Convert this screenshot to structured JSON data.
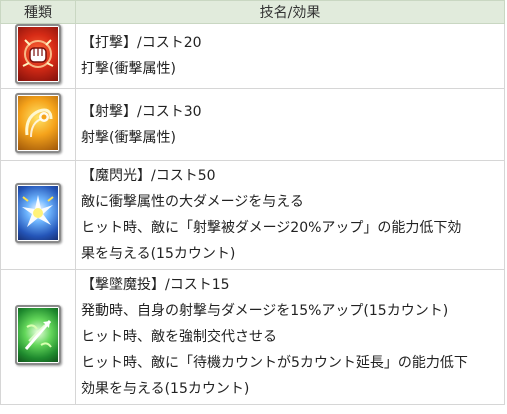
{
  "header": {
    "col_type": "種類",
    "col_effect": "技名/効果"
  },
  "rows": [
    {
      "icon": "fist-strike-icon",
      "color": "#d62b16",
      "lines": [
        "【打撃】/コスト20",
        "打撃(衝撃属性)"
      ]
    },
    {
      "icon": "shot-swirl-icon",
      "color": "#f5a31b",
      "lines": [
        "【射撃】/コスト30",
        "射撃(衝撃属性)"
      ]
    },
    {
      "icon": "magic-flash-icon",
      "color": "#2455b8",
      "lines": [
        "【魔閃光】/コスト50",
        "敵に衝撃属性の大ダメージを与える",
        "ヒット時、敵に「射撃被ダメージ20%アップ」の能力低下効",
        "果を与える(15カウント)"
      ]
    },
    {
      "icon": "crash-magic-throw-icon",
      "color": "#1f8a2e",
      "lines": [
        "【撃墜魔投】/コスト15",
        "発動時、自身の射撃与ダメージを15%アップ(15カウント)",
        "ヒット時、敵を強制交代させる",
        "ヒット時、敵に「待機カウントが5カウント延長」の能力低下",
        "効果を与える(15カウント)"
      ]
    }
  ]
}
